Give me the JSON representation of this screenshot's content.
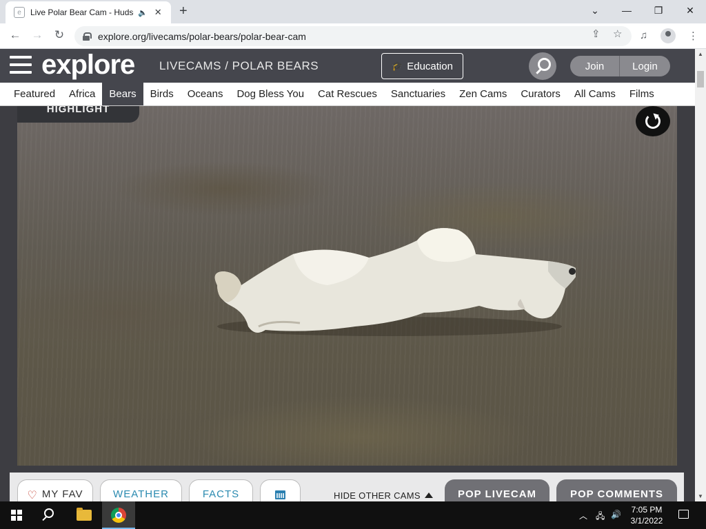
{
  "browser": {
    "tab_title": "Live Polar Bear Cam - Hudso",
    "url": "explore.org/livecams/polar-bears/polar-bear-cam",
    "new_tab": "+",
    "tab_close": "✕",
    "audio_icon": "🔈"
  },
  "site": {
    "logo": "explore",
    "breadcrumb": "LIVECAMS / POLAR BEARS",
    "education_label": "Education",
    "join_label": "Join",
    "login_label": "Login",
    "categories": [
      {
        "label": "Featured"
      },
      {
        "label": "Africa"
      },
      {
        "label": "Bears"
      },
      {
        "label": "Birds"
      },
      {
        "label": "Oceans"
      },
      {
        "label": "Dog Bless You"
      },
      {
        "label": "Cat Rescues"
      },
      {
        "label": "Sanctuaries"
      },
      {
        "label": "Zen Cams"
      },
      {
        "label": "Curators"
      },
      {
        "label": "All Cams"
      },
      {
        "label": "Films"
      }
    ],
    "active_category": "Bears"
  },
  "cam": {
    "highlight_label": "HIGHLIGHT"
  },
  "controls": {
    "my_fav": "MY FAV",
    "weather": "WEATHER",
    "facts": "FACTS",
    "hide_other_cams": "HIDE OTHER CAMS",
    "pop_livecam": "POP LIVECAM",
    "pop_comments": "POP COMMENTS"
  },
  "taskbar": {
    "time": "7:05 PM",
    "date": "3/1/2022"
  },
  "colors": {
    "header_bg": "#45464d",
    "link_blue": "#2a8ab0",
    "pop_button": "#707075"
  },
  "icons": [
    "chrome-favicon",
    "audio-icon",
    "close-icon",
    "back-icon",
    "forward-icon",
    "reload-icon",
    "lock-icon",
    "share-icon",
    "star-icon",
    "media-icon",
    "profile-icon",
    "menu-icon",
    "hamburger-icon",
    "graduation-cap-icon",
    "search-icon",
    "refresh-icon",
    "heart-icon",
    "calendar-icon",
    "triangle-up-icon",
    "windows-icon",
    "folder-icon",
    "chrome-icon",
    "network-icon",
    "volume-icon",
    "notification-icon"
  ]
}
